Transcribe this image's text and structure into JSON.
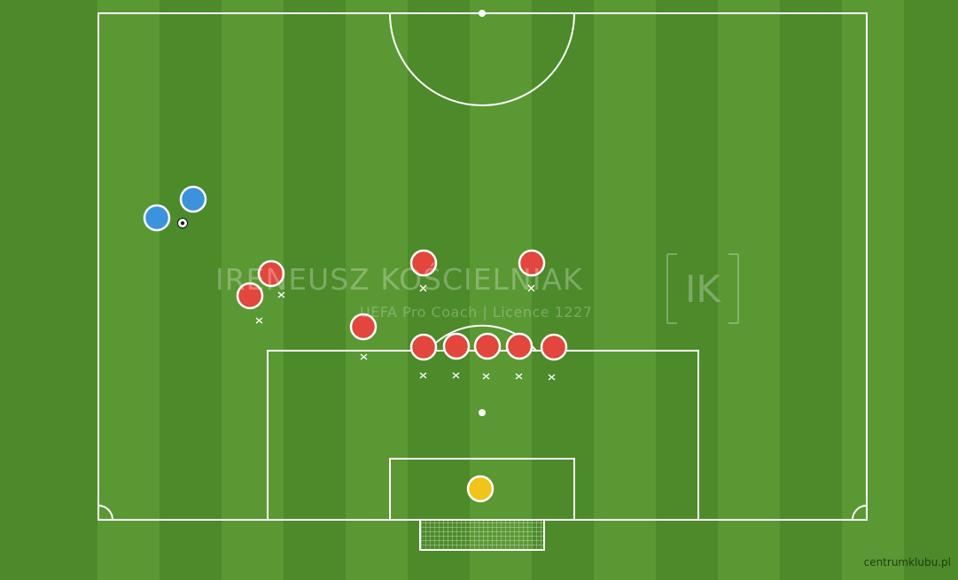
{
  "pitch": {
    "grass_light": "#5a9a34",
    "grass_dark": "#4c8a2a",
    "line_color": "#ffffff"
  },
  "watermark": {
    "name": "IRENEUSZ KOŚCIELNIAK",
    "subtitle": "UEFA Pro Coach  |  Licence 1227",
    "logo_text": "IK"
  },
  "credit": "centrumklubu.pl",
  "colors": {
    "attacker": "#3a93dc",
    "defender": "#e2463c",
    "goalkeeper": "#f0c419"
  },
  "icons": {
    "ball": "soccer-ball-icon",
    "marker": "cross-marker-icon"
  }
}
